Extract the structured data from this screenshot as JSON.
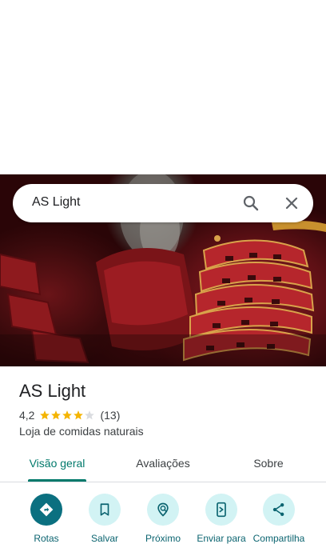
{
  "search": {
    "query": "AS Light",
    "icons": [
      "search-icon",
      "close-icon"
    ]
  },
  "place": {
    "name": "AS Light",
    "rating": "4,2",
    "stars": 4,
    "reviews_count": "(13)",
    "category": "Loja de comidas naturais"
  },
  "tabs": [
    {
      "label": "Visão geral",
      "active": true
    },
    {
      "label": "Avaliações",
      "active": false
    },
    {
      "label": "Sobre",
      "active": false
    }
  ],
  "actions": [
    {
      "label": "Rotas",
      "icon": "directions-icon"
    },
    {
      "label": "Salvar",
      "icon": "bookmark-icon"
    },
    {
      "label": "Próximo",
      "icon": "nearby-icon"
    },
    {
      "label": "Enviar para",
      "icon": "send-to-phone-icon"
    },
    {
      "label": "Compartilha",
      "icon": "share-icon"
    }
  ],
  "colors": {
    "accent": "#00796b",
    "action_primary_bg": "#0b7080",
    "action_bg": "#d2f3f4",
    "star": "#f4b400",
    "star_empty": "#dadce0"
  }
}
